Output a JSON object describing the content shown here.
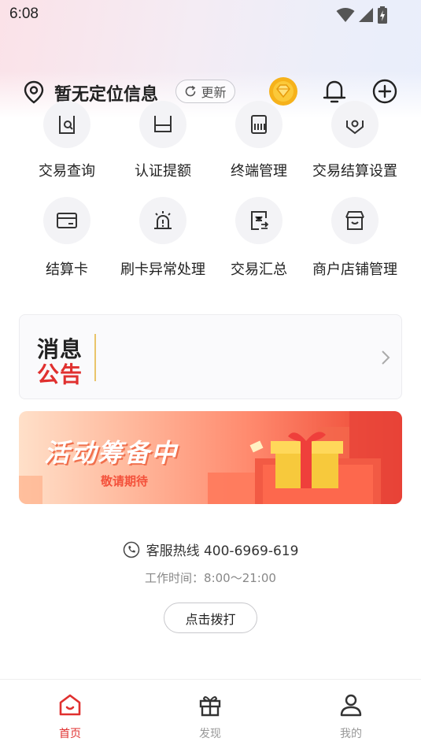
{
  "status_bar": {
    "time": "6:08"
  },
  "header": {
    "location_text": "暂无定位信息",
    "refresh_label": "更新"
  },
  "grid": {
    "items": [
      {
        "label": "交易查询",
        "icon": "transaction-search-icon"
      },
      {
        "label": "认证提额",
        "icon": "certification-limit-icon"
      },
      {
        "label": "终端管理",
        "icon": "terminal-management-icon"
      },
      {
        "label": "交易结算设置",
        "icon": "settlement-settings-icon"
      },
      {
        "label": "结算卡",
        "icon": "settlement-card-icon"
      },
      {
        "label": "刷卡异常处理",
        "icon": "alarm-icon"
      },
      {
        "label": "交易汇总",
        "icon": "transaction-summary-icon"
      },
      {
        "label": "商户店铺管理",
        "icon": "store-icon"
      }
    ]
  },
  "notice": {
    "line1": "消息",
    "line2": "公告"
  },
  "banner": {
    "title": "活动筹备中",
    "subtitle": "敬请期待"
  },
  "service": {
    "hotline": "客服热线 400-6969-619",
    "hours": "工作时间：8:00～21:00",
    "dial_label": "点击拨打"
  },
  "bottom_nav": {
    "items": [
      {
        "label": "首页",
        "icon": "home-icon",
        "active": true
      },
      {
        "label": "发现",
        "icon": "gift-icon",
        "active": false
      },
      {
        "label": "我的",
        "icon": "profile-icon",
        "active": false
      }
    ]
  },
  "colors": {
    "accent": "#e0302f",
    "gold": "#f5a623",
    "muted": "#999999"
  }
}
